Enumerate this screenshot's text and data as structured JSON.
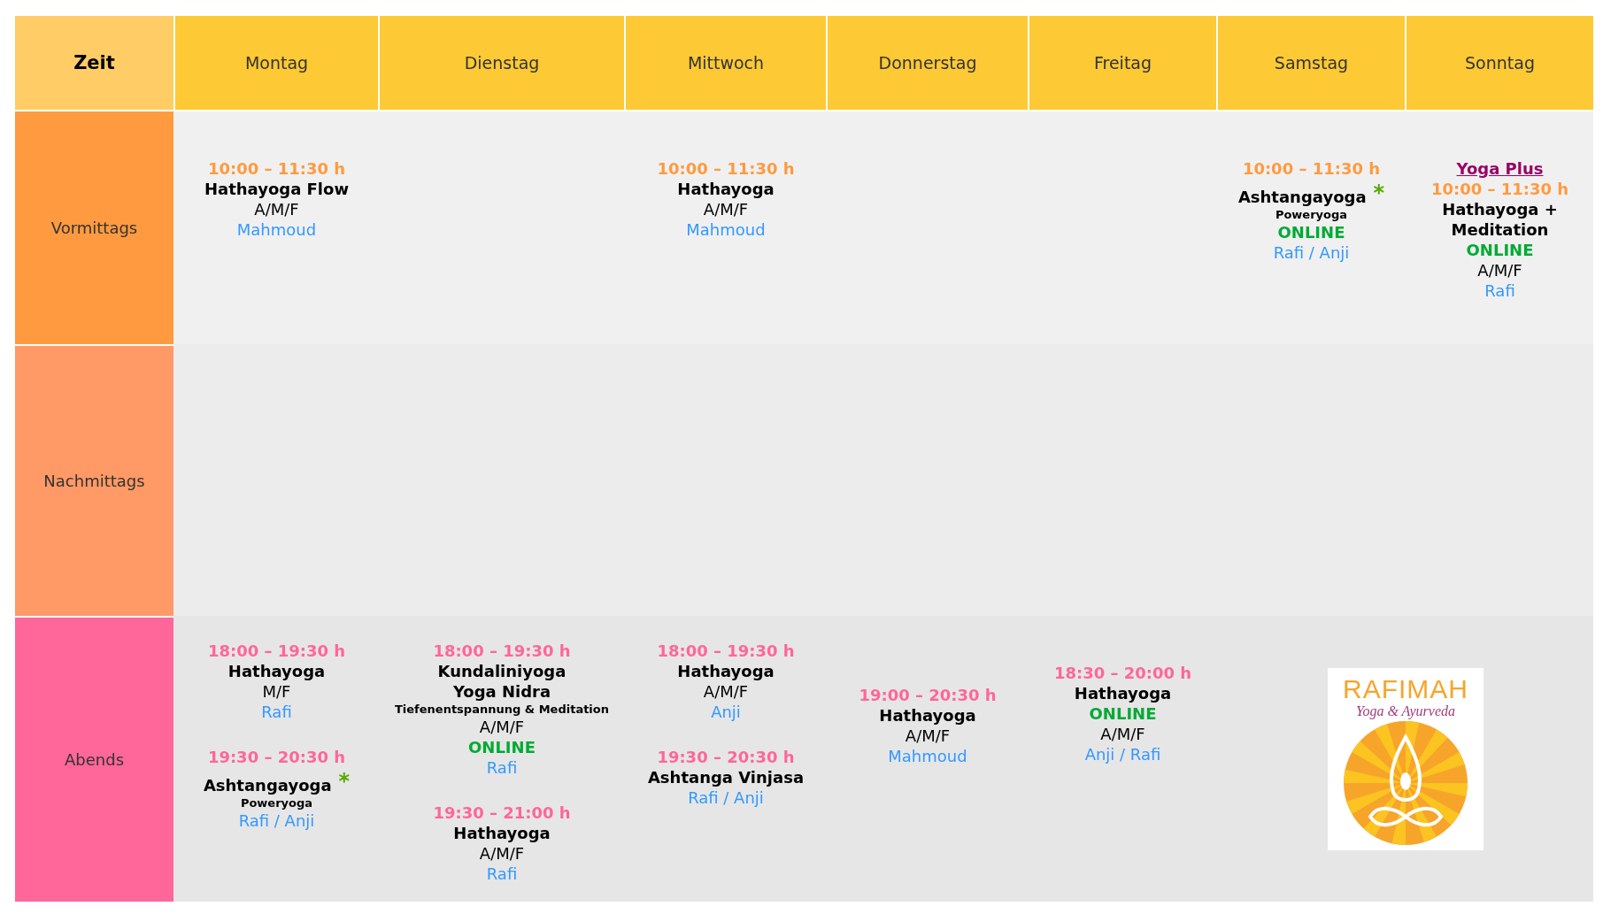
{
  "header": {
    "corner": "Zeit",
    "days": [
      "Montag",
      "Dienstag",
      "Mittwoch",
      "Donnerstag",
      "Freitag",
      "Samstag",
      "Sonntag"
    ]
  },
  "rows": [
    {
      "label": "Vormittags",
      "color": "#ff9a40",
      "kind": "morning",
      "cells": [
        [
          {
            "lines": [
              {
                "kind": "time",
                "text": "10:00 – 11:30 h"
              },
              {
                "kind": "title",
                "text": "Hathayoga Flow"
              },
              {
                "kind": "level",
                "text": "A/M/F"
              },
              {
                "kind": "teacher",
                "text": "Mahmoud"
              }
            ]
          }
        ],
        [],
        [
          {
            "lines": [
              {
                "kind": "time",
                "text": "10:00 – 11:30 h"
              },
              {
                "kind": "title",
                "text": "Hathayoga"
              },
              {
                "kind": "level",
                "text": "A/M/F"
              },
              {
                "kind": "teacher",
                "text": "Mahmoud"
              }
            ]
          }
        ],
        [],
        [],
        [
          {
            "lines": [
              {
                "kind": "time",
                "text": "10:00 – 11:30 h"
              },
              {
                "kind": "title",
                "text": "Ashtangayoga",
                "mark": "*"
              },
              {
                "kind": "subtitle",
                "text": "Poweryoga"
              },
              {
                "kind": "online",
                "text": "ONLINE"
              },
              {
                "kind": "teacher",
                "text": "Rafi / Anji"
              }
            ]
          }
        ],
        [
          {
            "lines": [
              {
                "kind": "link",
                "text": "Yoga Plus"
              },
              {
                "kind": "time",
                "text": "10:00 – 11:30 h"
              },
              {
                "kind": "title",
                "text": "Hathayoga + Meditation"
              },
              {
                "kind": "online",
                "text": "ONLINE"
              },
              {
                "kind": "level",
                "text": "A/M/F"
              },
              {
                "kind": "teacher",
                "text": "Rafi"
              }
            ]
          }
        ]
      ]
    },
    {
      "label": "Nachmittags",
      "color": "#ff9966",
      "kind": "afternoon",
      "cells": [
        [],
        [],
        [],
        [],
        [],
        [],
        []
      ]
    },
    {
      "label": "Abends",
      "color": "#ff6699",
      "kind": "evening",
      "cells": [
        [
          {
            "lines": [
              {
                "kind": "time",
                "text": "18:00 – 19:30 h"
              },
              {
                "kind": "title",
                "text": "Hathayoga"
              },
              {
                "kind": "level",
                "text": "M/F"
              },
              {
                "kind": "teacher",
                "text": "Rafi"
              }
            ]
          },
          {
            "lines": [
              {
                "kind": "time",
                "text": "19:30 – 20:30 h"
              },
              {
                "kind": "title",
                "text": "Ashtangayoga",
                "mark": "*"
              },
              {
                "kind": "subtitle",
                "text": "Poweryoga"
              },
              {
                "kind": "teacher",
                "text": "Rafi / Anji"
              }
            ]
          }
        ],
        [
          {
            "lines": [
              {
                "kind": "time",
                "text": "18:00 – 19:30 h"
              },
              {
                "kind": "title",
                "text": "Kundaliniyoga"
              },
              {
                "kind": "title",
                "text": "Yoga Nidra"
              },
              {
                "kind": "subtitle",
                "text": "Tiefenentspannung & Meditation"
              },
              {
                "kind": "level",
                "text": "A/M/F"
              },
              {
                "kind": "online",
                "text": "ONLINE"
              },
              {
                "kind": "teacher",
                "text": "Rafi"
              }
            ]
          },
          {
            "lines": [
              {
                "kind": "time",
                "text": "19:30 – 21:00 h"
              },
              {
                "kind": "title",
                "text": "Hathayoga"
              },
              {
                "kind": "level",
                "text": "A/M/F"
              },
              {
                "kind": "teacher",
                "text": "Rafi"
              }
            ]
          }
        ],
        [
          {
            "lines": [
              {
                "kind": "time",
                "text": "18:00 – 19:30 h"
              },
              {
                "kind": "title",
                "text": "Hathayoga"
              },
              {
                "kind": "level",
                "text": "A/M/F"
              },
              {
                "kind": "teacher",
                "text": "Anji"
              }
            ]
          },
          {
            "lines": [
              {
                "kind": "time",
                "text": "19:30 – 20:30 h"
              },
              {
                "kind": "title",
                "text": "Ashtanga Vinjasa"
              },
              {
                "kind": "teacher",
                "text": "Rafi / Anji"
              }
            ]
          }
        ],
        [
          {
            "lines": [
              {
                "kind": "time",
                "text": "19:00 – 20:30 h"
              },
              {
                "kind": "title",
                "text": "Hathayoga"
              },
              {
                "kind": "level",
                "text": "A/M/F"
              },
              {
                "kind": "teacher",
                "text": "Mahmoud"
              }
            ]
          }
        ],
        [
          {
            "lines": [
              {
                "kind": "time",
                "text": "18:30 – 20:00 h"
              },
              {
                "kind": "title",
                "text": "Hathayoga"
              },
              {
                "kind": "online",
                "text": "ONLINE"
              },
              {
                "kind": "level",
                "text": "A/M/F"
              },
              {
                "kind": "teacher",
                "text": "Anji / Rafi"
              }
            ]
          }
        ]
      ],
      "logo": {
        "name": "RAFIMAH",
        "tagline": "Yoga & Ayurveda"
      }
    }
  ]
}
